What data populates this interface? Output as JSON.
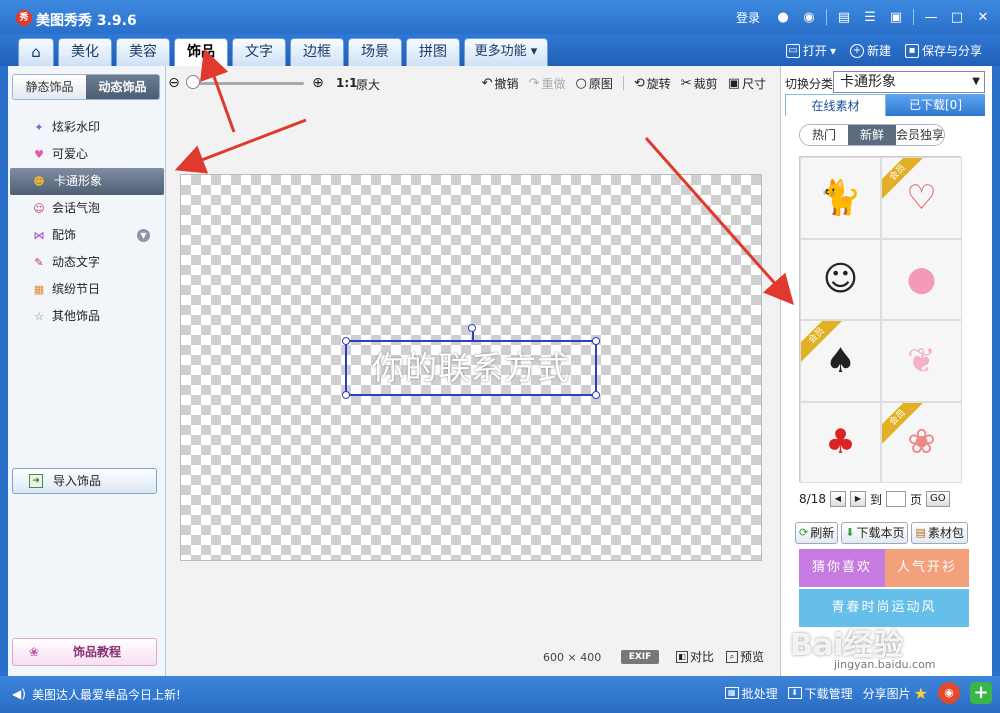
{
  "window": {
    "app_title": "美图秀秀 3.9.6",
    "login_label": "登录",
    "controls": [
      "minimize",
      "restore",
      "close"
    ]
  },
  "nav": {
    "tabs": [
      {
        "label": "⌂",
        "icon": "home-icon"
      },
      {
        "label": "美化"
      },
      {
        "label": "美容"
      },
      {
        "label": "饰品",
        "active": true
      },
      {
        "label": "文字"
      },
      {
        "label": "边框"
      },
      {
        "label": "场景"
      },
      {
        "label": "拼图"
      },
      {
        "label": "更多功能 ▾"
      }
    ],
    "open_label": "打开",
    "new_label": "新建",
    "save_label": "保存与分享"
  },
  "left": {
    "static_tab": "静态饰品",
    "dynamic_tab": "动态饰品",
    "categories": [
      {
        "label": "炫彩水印",
        "icon": "sparkle-icon"
      },
      {
        "label": "可爱心",
        "icon": "heart-icon"
      },
      {
        "label": "卡通形象",
        "icon": "cartoon-face-icon",
        "active": true
      },
      {
        "label": "会话气泡",
        "icon": "speech-bubble-icon"
      },
      {
        "label": "配饰",
        "icon": "bow-icon"
      },
      {
        "label": "动态文字",
        "icon": "text-icon"
      },
      {
        "label": "缤纷节日",
        "icon": "gift-icon"
      },
      {
        "label": "其他饰品",
        "icon": "star-icon"
      }
    ],
    "import_label": "导入饰品",
    "tutorial_label": "饰品教程"
  },
  "toolbar": {
    "one_to_one": "1:1",
    "original_size": "原大",
    "zoom_level": 0,
    "undo": "撤销",
    "redo": "重做",
    "original": "原图",
    "rotate": "旋转",
    "crop": "裁剪",
    "resize": "尺寸"
  },
  "canvas": {
    "text_content": "你的联系方式",
    "width_value": "600",
    "times": "×",
    "height_value": "400",
    "exif_label": "EXIF",
    "compare_label": "对比",
    "preview_label": "预览"
  },
  "right": {
    "switch_label": "切换分类",
    "category_selected": "卡通形象",
    "online_tab": "在线素材",
    "downloaded_tab": "已下载[0]",
    "filters": [
      {
        "label": "热门"
      },
      {
        "label": "新鲜",
        "active": true
      },
      {
        "label": "会员独享"
      }
    ],
    "grid": [
      {
        "icon": "black-cat-icon",
        "vip": false
      },
      {
        "icon": "couple-love-icon",
        "vip": true
      },
      {
        "icon": "hanging-girl-icon",
        "vip": false
      },
      {
        "icon": "pink-pig-icon",
        "vip": false
      },
      {
        "icon": "black-bear-heart-icon",
        "vip": true
      },
      {
        "icon": "bunny-bow-icon",
        "vip": false
      },
      {
        "icon": "red-bow-girl-icon",
        "vip": false
      },
      {
        "icon": "balloon-girl-icon",
        "vip": true
      }
    ],
    "vip_label": "会员",
    "page_text": "8/18",
    "goto_label": "到",
    "page_unit": "页",
    "go_label": "GO",
    "refresh_label": "刷新",
    "download_page_label": "下载本页",
    "pack_label": "素材包",
    "banner_1": "猜你喜欢",
    "banner_2": "人气开衫",
    "banner_3": "青春时尚运动风"
  },
  "status": {
    "news": "美图达人最爱单品今日上新!",
    "batch_label": "批处理",
    "download_mgr_label": "下载管理",
    "share_label": "分享图片"
  },
  "watermark": {
    "brand": "Bai经验",
    "url": "jingyan.baidu.com"
  },
  "colors": {
    "titlebar": "#2a6fc9",
    "selection": "#2f3fbf",
    "annotation_arrow": "#e03a2e"
  }
}
